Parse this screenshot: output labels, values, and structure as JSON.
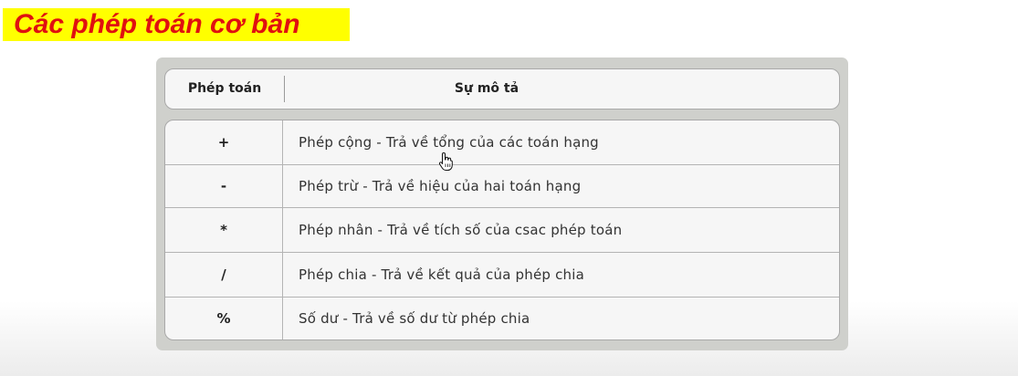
{
  "title": "Các phép toán cơ bản",
  "table": {
    "header": {
      "operator": "Phép toán",
      "description": "Sự mô tả"
    },
    "rows": [
      {
        "operator": "+",
        "description": "Phép cộng - Trả về tổng của các toán hạng"
      },
      {
        "operator": "-",
        "description": "Phép trừ - Trả về hiệu của hai toán hạng"
      },
      {
        "operator": "*",
        "description": "Phép nhân - Trả về tích số của csac phép toán"
      },
      {
        "operator": "/",
        "description": "Phép chia - Trả về kết quả của phép chia"
      },
      {
        "operator": "%",
        "description": "Số dư - Trả về số dư từ phép chia"
      }
    ]
  },
  "colors": {
    "title_background": "#ffff00",
    "title_text": "#e01010",
    "panel": "#cfd0cc",
    "table_background": "#f6f6f6"
  },
  "icons": {
    "pointer": "hand-pointer-icon"
  }
}
